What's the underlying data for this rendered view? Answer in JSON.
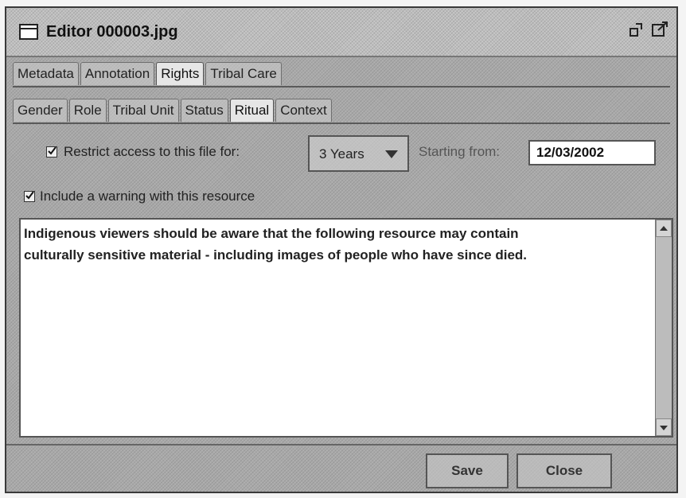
{
  "window": {
    "title": "Editor 000003.jpg"
  },
  "tabs_outer": [
    {
      "label": "Metadata",
      "active": false
    },
    {
      "label": "Annotation",
      "active": false
    },
    {
      "label": "Rights",
      "active": true
    },
    {
      "label": "Tribal Care",
      "active": false
    }
  ],
  "tabs_inner": [
    {
      "label": "Gender",
      "active": false
    },
    {
      "label": "Role",
      "active": false
    },
    {
      "label": "Tribal Unit",
      "active": false
    },
    {
      "label": "Status",
      "active": false
    },
    {
      "label": "Ritual",
      "active": true
    },
    {
      "label": "Context",
      "active": false
    }
  ],
  "restrict": {
    "checked": true,
    "label": "Restrict access to this file for:",
    "duration": "3 Years",
    "starting_label": "Starting from:",
    "start_date": "12/03/2002"
  },
  "warning": {
    "checked": true,
    "label": "Include a warning with this resource",
    "text_line1": "Indigenous viewers should be aware that the following resource may contain",
    "text_line2": "culturally sensitive material - including images of people who have since died."
  },
  "buttons": {
    "save": "Save",
    "close": "Close"
  }
}
